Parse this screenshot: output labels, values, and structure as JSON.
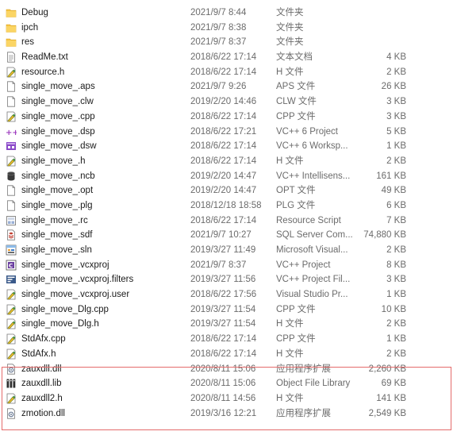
{
  "files": [
    {
      "name": "Debug",
      "date": "2021/9/7 8:44",
      "type": "文件夹",
      "size": "",
      "icon": "folder-icon"
    },
    {
      "name": "ipch",
      "date": "2021/9/7 8:38",
      "type": "文件夹",
      "size": "",
      "icon": "folder-icon"
    },
    {
      "name": "res",
      "date": "2021/9/7 8:37",
      "type": "文件夹",
      "size": "",
      "icon": "folder-icon"
    },
    {
      "name": "ReadMe.txt",
      "date": "2018/6/22 17:14",
      "type": "文本文档",
      "size": "4 KB",
      "icon": "text-file-icon"
    },
    {
      "name": "resource.h",
      "date": "2018/6/22 17:14",
      "type": "H 文件",
      "size": "2 KB",
      "icon": "code-file-icon"
    },
    {
      "name": "single_move_.aps",
      "date": "2021/9/7 9:26",
      "type": "APS 文件",
      "size": "26 KB",
      "icon": "blank-file-icon"
    },
    {
      "name": "single_move_.clw",
      "date": "2019/2/20 14:46",
      "type": "CLW 文件",
      "size": "3 KB",
      "icon": "blank-file-icon"
    },
    {
      "name": "single_move_.cpp",
      "date": "2018/6/22 17:14",
      "type": "CPP 文件",
      "size": "3 KB",
      "icon": "code-file-icon"
    },
    {
      "name": "single_move_.dsp",
      "date": "2018/6/22 17:21",
      "type": "VC++ 6 Project",
      "size": "5 KB",
      "icon": "vc6-project-icon"
    },
    {
      "name": "single_move_.dsw",
      "date": "2018/6/22 17:14",
      "type": "VC++ 6 Worksp...",
      "size": "1 KB",
      "icon": "vc6-workspace-icon"
    },
    {
      "name": "single_move_.h",
      "date": "2018/6/22 17:14",
      "type": "H 文件",
      "size": "2 KB",
      "icon": "code-file-icon"
    },
    {
      "name": "single_move_.ncb",
      "date": "2019/2/20 14:47",
      "type": "VC++ Intellisens...",
      "size": "161 KB",
      "icon": "database-icon"
    },
    {
      "name": "single_move_.opt",
      "date": "2019/2/20 14:47",
      "type": "OPT 文件",
      "size": "49 KB",
      "icon": "blank-file-icon"
    },
    {
      "name": "single_move_.plg",
      "date": "2018/12/18 18:58",
      "type": "PLG 文件",
      "size": "6 KB",
      "icon": "blank-file-icon"
    },
    {
      "name": "single_move_.rc",
      "date": "2018/6/22 17:14",
      "type": "Resource Script",
      "size": "7 KB",
      "icon": "resource-script-icon"
    },
    {
      "name": "single_move_.sdf",
      "date": "2021/9/7 10:27",
      "type": "SQL Server Com...",
      "size": "74,880 KB",
      "icon": "sql-file-icon"
    },
    {
      "name": "single_move_.sln",
      "date": "2019/3/27 11:49",
      "type": "Microsoft Visual...",
      "size": "2 KB",
      "icon": "solution-file-icon"
    },
    {
      "name": "single_move_.vcxproj",
      "date": "2021/9/7 8:37",
      "type": "VC++ Project",
      "size": "8 KB",
      "icon": "vcxproj-icon"
    },
    {
      "name": "single_move_.vcxproj.filters",
      "date": "2019/3/27 11:56",
      "type": "VC++ Project Fil...",
      "size": "3 KB",
      "icon": "filters-file-icon"
    },
    {
      "name": "single_move_.vcxproj.user",
      "date": "2018/6/22 17:56",
      "type": "Visual Studio Pr...",
      "size": "1 KB",
      "icon": "code-file-icon"
    },
    {
      "name": "single_move_Dlg.cpp",
      "date": "2019/3/27 11:54",
      "type": "CPP 文件",
      "size": "10 KB",
      "icon": "code-file-icon"
    },
    {
      "name": "single_move_Dlg.h",
      "date": "2019/3/27 11:54",
      "type": "H 文件",
      "size": "2 KB",
      "icon": "code-file-icon"
    },
    {
      "name": "StdAfx.cpp",
      "date": "2018/6/22 17:14",
      "type": "CPP 文件",
      "size": "1 KB",
      "icon": "code-file-icon"
    },
    {
      "name": "StdAfx.h",
      "date": "2018/6/22 17:14",
      "type": "H 文件",
      "size": "2 KB",
      "icon": "code-file-icon"
    },
    {
      "name": "zauxdll.dll",
      "date": "2020/8/11 15:06",
      "type": "应用程序扩展",
      "size": "2,260 KB",
      "icon": "dll-file-icon"
    },
    {
      "name": "zauxdll.lib",
      "date": "2020/8/11 15:06",
      "type": "Object File Library",
      "size": "69 KB",
      "icon": "lib-file-icon"
    },
    {
      "name": "zauxdll2.h",
      "date": "2020/8/11 14:56",
      "type": "H 文件",
      "size": "141 KB",
      "icon": "code-file-icon"
    },
    {
      "name": "zmotion.dll",
      "date": "2019/3/16 12:21",
      "type": "应用程序扩展",
      "size": "2,549 KB",
      "icon": "dll-file-icon"
    }
  ],
  "colors": {
    "folder": "#f6c443",
    "highlight_border": "#e46b6b",
    "secondary_text": "#6b6b6b"
  }
}
